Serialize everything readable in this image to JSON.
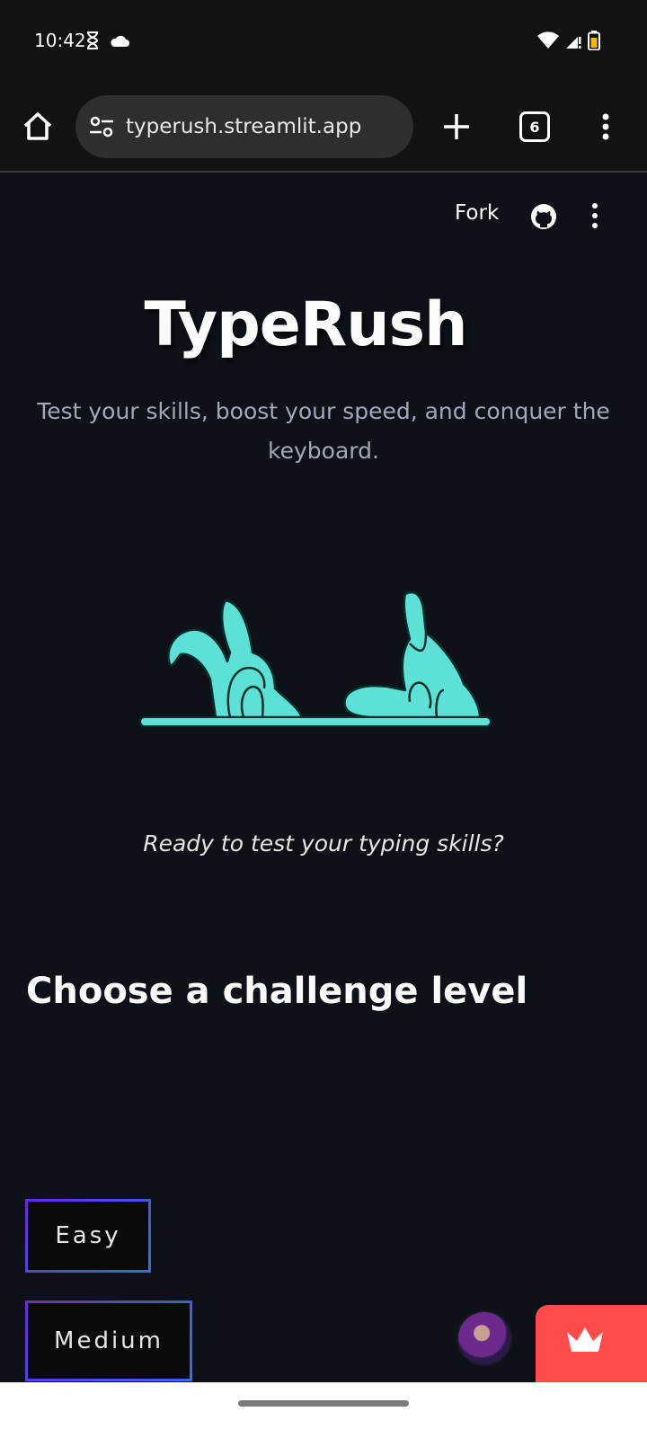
{
  "status_bar": {
    "time": "10:42",
    "icons": [
      "hourglass-icon",
      "cloud-icon",
      "wifi-icon",
      "signal-icon",
      "battery-icon"
    ]
  },
  "browser": {
    "url": "typerush.streamlit.app",
    "tab_count": "6"
  },
  "app_header": {
    "fork_label": "Fork"
  },
  "main": {
    "title": "TypeRush",
    "subtitle": "Test your skills, boost your speed, and conquer the keyboard.",
    "tagline": "Ready to test your typing skills?",
    "section_heading": "Choose a challenge level",
    "levels": [
      {
        "label": "Easy"
      },
      {
        "label": "Medium"
      }
    ]
  },
  "colors": {
    "background": "#0e1117",
    "illustration": "#5de0d6",
    "button_border_start": "#6a2bd9",
    "button_border_end": "#2f6fe8",
    "streamlit_badge": "#ff4b4b"
  }
}
